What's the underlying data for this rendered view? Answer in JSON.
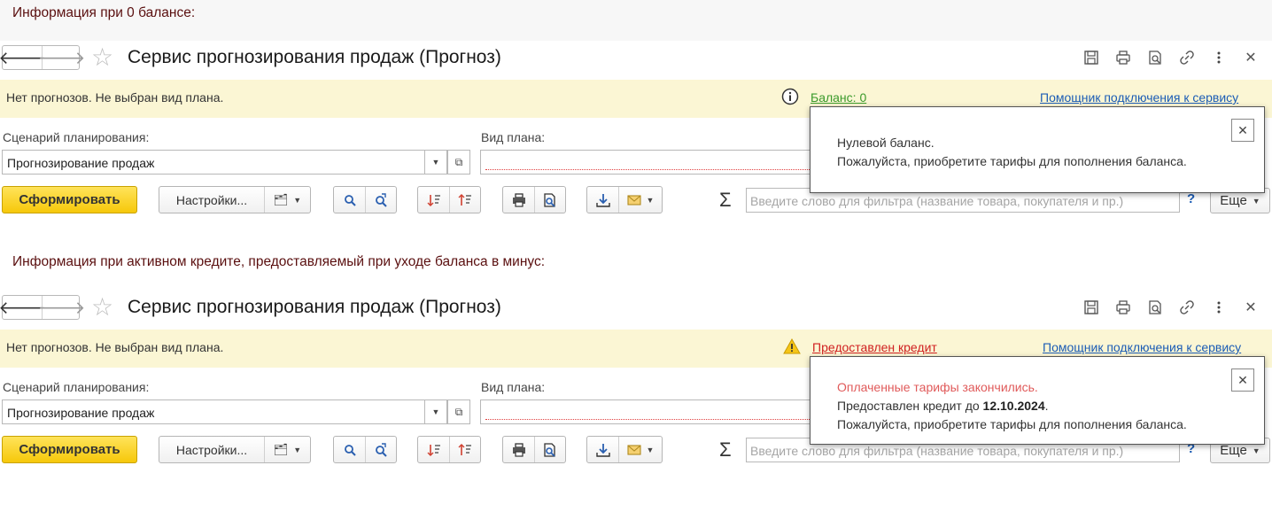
{
  "captions": {
    "zero_balance": "Информация при 0 балансе:",
    "credit": "Информация при активном кредите, предоставляемый при уходе баланса в минус:"
  },
  "panels": [
    {
      "title": "Сервис прогнозирования продаж (Прогноз)",
      "info_text": "Нет прогнозов. Не выбран вид плана.",
      "status_icon": "info-icon",
      "status_link": "Баланс: 0",
      "status_color": "#3a9a2a",
      "assistant_link": "Помощник подключения к сервису",
      "scenario_label": "Сценарий планирования:",
      "scenario_value": "Прогнозирование продаж",
      "plan_label": "Вид плана:",
      "generate_button": "Сформировать",
      "settings_button": "Настройки...",
      "filter_placeholder": "Введите слово для фильтра (название товара, покупателя и пр.)",
      "help": "?",
      "more_button": "Еще",
      "popup": {
        "line1": "",
        "line2_prefix": "Нулевой баланс.",
        "line2_bold": "",
        "line2_suffix": "",
        "line3": "Пожалуйста, приобретите тарифы для пополнения баланса."
      }
    },
    {
      "title": "Сервис прогнозирования продаж (Прогноз)",
      "info_text": "Нет прогнозов. Не выбран вид плана.",
      "status_icon": "warning-icon",
      "status_link": "Предоставлен кредит",
      "status_color": "#d02020",
      "assistant_link": "Помощник подключения к сервису",
      "scenario_label": "Сценарий планирования:",
      "scenario_value": "Прогнозирование продаж",
      "plan_label": "Вид плана:",
      "generate_button": "Сформировать",
      "settings_button": "Настройки...",
      "filter_placeholder": "Введите слово для фильтра (название товара, покупателя и пр.)",
      "help": "?",
      "more_button": "Еще",
      "popup": {
        "line1": "Оплаченные тарифы закончились.",
        "line2_prefix": "Предоставлен кредит до ",
        "line2_bold": "12.10.2024",
        "line2_suffix": ".",
        "line3": "Пожалуйста, приобретите тарифы для пополнения баланса."
      }
    }
  ]
}
